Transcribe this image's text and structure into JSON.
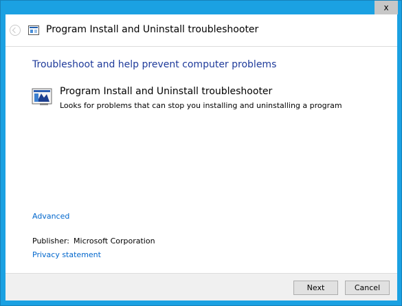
{
  "window": {
    "close_glyph": "x",
    "title": "Program Install and Uninstall troubleshooter"
  },
  "content": {
    "heading": "Troubleshoot and help prevent computer problems",
    "tool": {
      "name": "Program Install and Uninstall troubleshooter",
      "description": "Looks for problems that can stop you installing and uninstalling a program",
      "icon": "troubleshooter-icon"
    },
    "advanced_link": "Advanced",
    "publisher_label": "Publisher:",
    "publisher_value": "Microsoft Corporation",
    "privacy_link": "Privacy statement"
  },
  "footer": {
    "next_label": "Next",
    "cancel_label": "Cancel"
  },
  "colors": {
    "frame": "#1ba1e2",
    "heading": "#1e3a9a",
    "link": "#0066cc"
  }
}
